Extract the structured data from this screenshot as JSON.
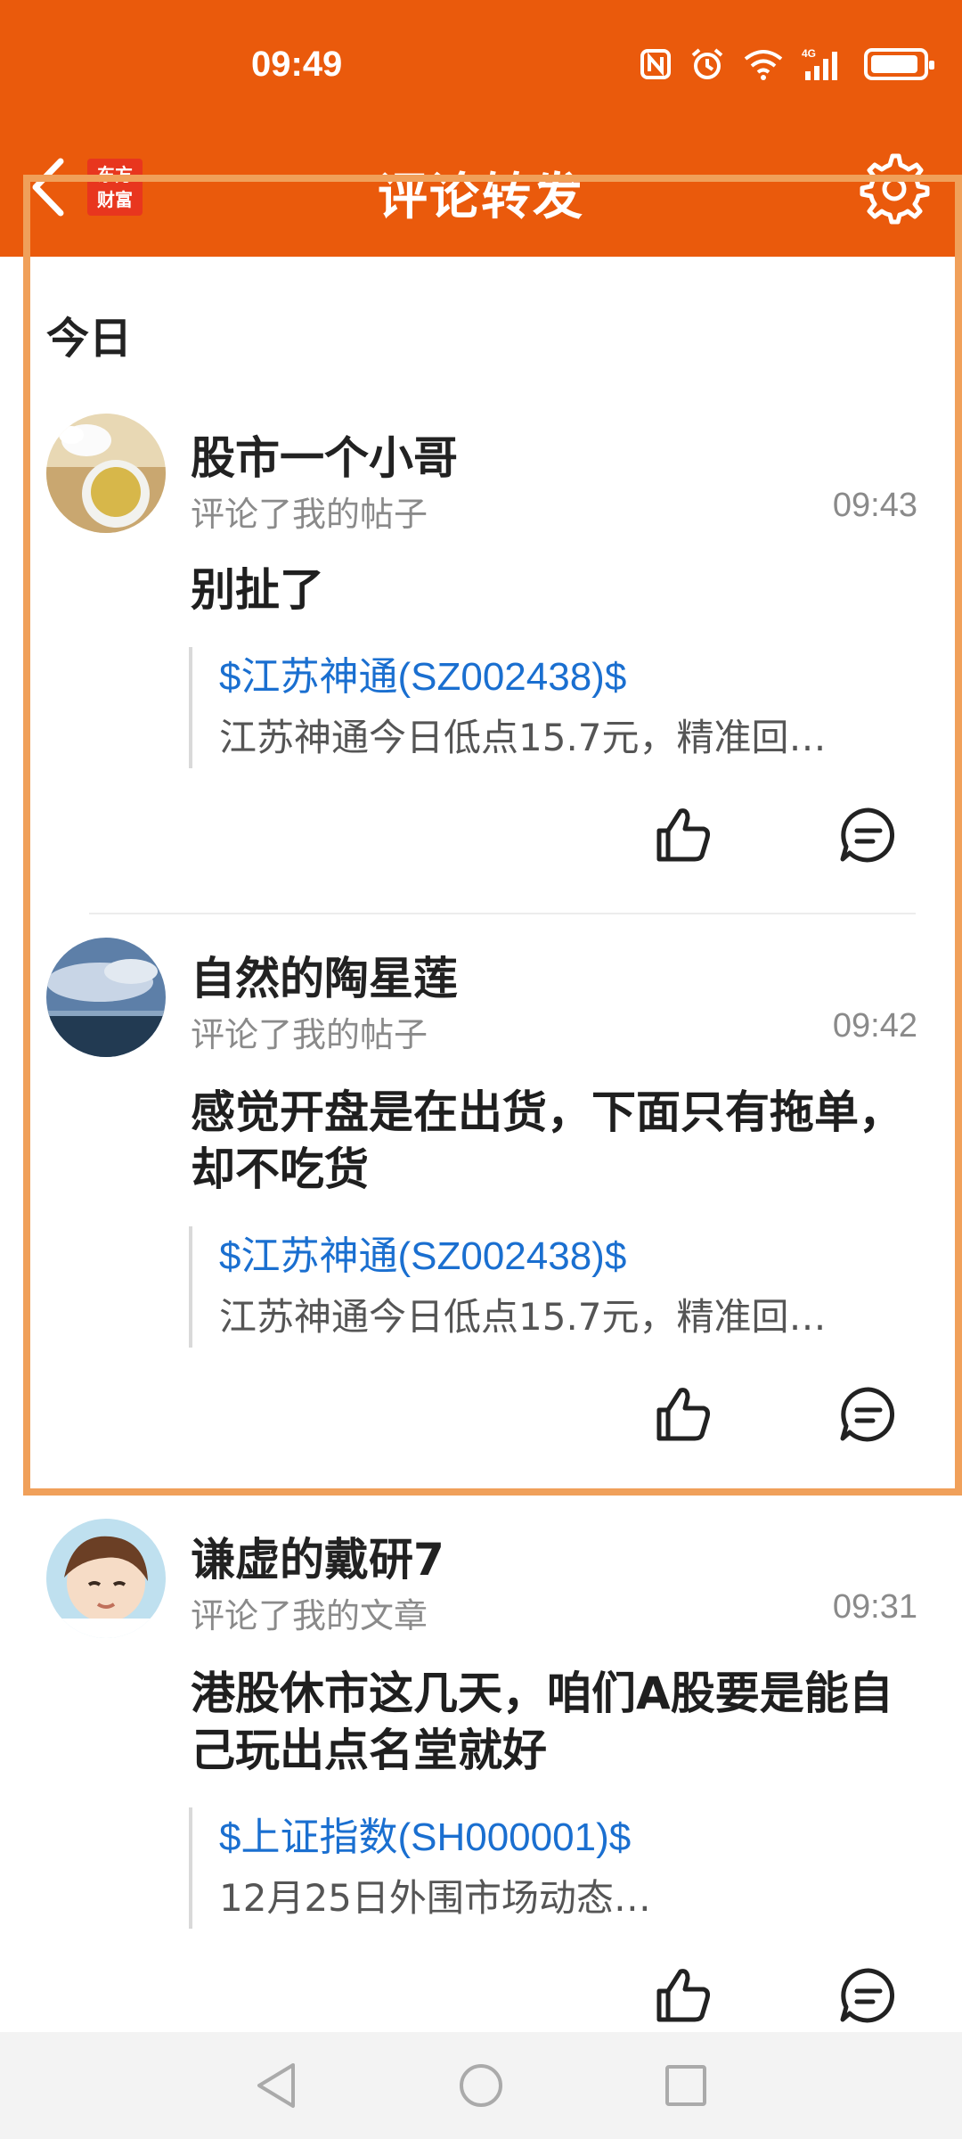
{
  "status_bar": {
    "time": "09:49",
    "network": "4G"
  },
  "header": {
    "title": "评论转发",
    "logo_text": "东方财富",
    "colors": {
      "header_bg": "#ea5a0c",
      "link": "#1a6fd0",
      "highlight": "#f0a05a"
    }
  },
  "section": {
    "label": "今日"
  },
  "feed": [
    {
      "username": "股市一个小哥",
      "action": "评论了我的帖子",
      "time": "09:43",
      "comment": "别扯了",
      "quote_link": "$江苏神通(SZ002438)$",
      "quote_text": "江苏神通今日低点15.7元，精准回…"
    },
    {
      "username": "自然的陶星莲",
      "action": "评论了我的帖子",
      "time": "09:42",
      "comment": "感觉开盘是在出货，下面只有拖单，却不吃货",
      "quote_link": "$江苏神通(SZ002438)$",
      "quote_text": "江苏神通今日低点15.7元，精准回…"
    },
    {
      "username": "谦虚的戴研7",
      "action": "评论了我的文章",
      "time": "09:31",
      "comment": "港股休市这几天，咱们A股要是能自己玩出点名堂就好",
      "quote_link": "$上证指数(SH000001)$",
      "quote_text": "12月25日外围市场动态…"
    }
  ]
}
